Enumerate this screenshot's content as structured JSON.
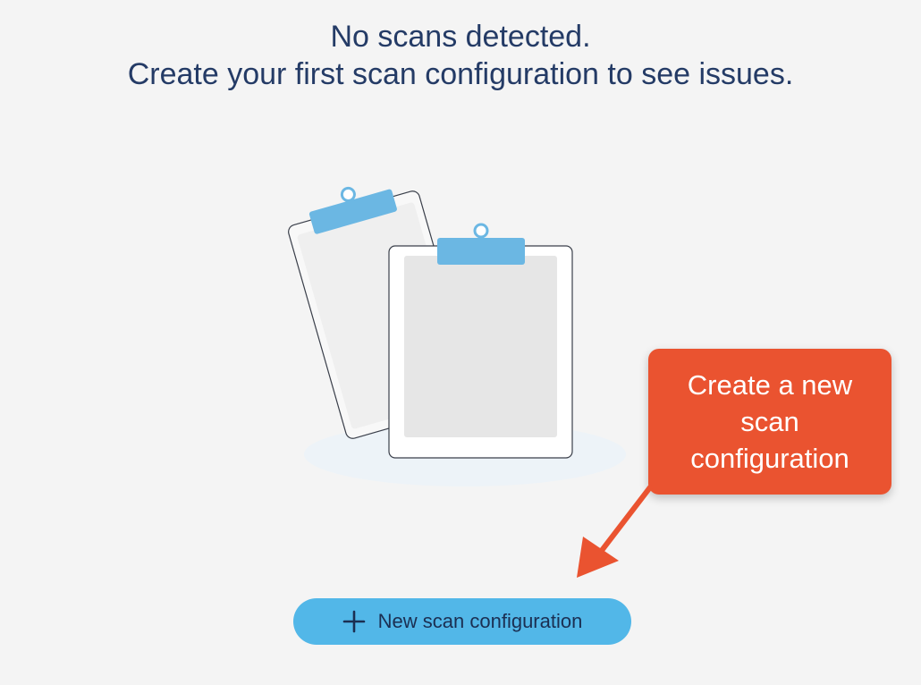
{
  "empty_state": {
    "line1": "No scans detected.",
    "line2": "Create your first scan configuration to see issues."
  },
  "illustration": {
    "icon": "clipboards-illustration"
  },
  "callout": {
    "text": "Create a new scan configuration",
    "color": "#ea5330"
  },
  "actions": {
    "new_scan_label": "New scan configuration",
    "new_scan_icon": "plus-icon",
    "button_color": "#52b7e8"
  }
}
